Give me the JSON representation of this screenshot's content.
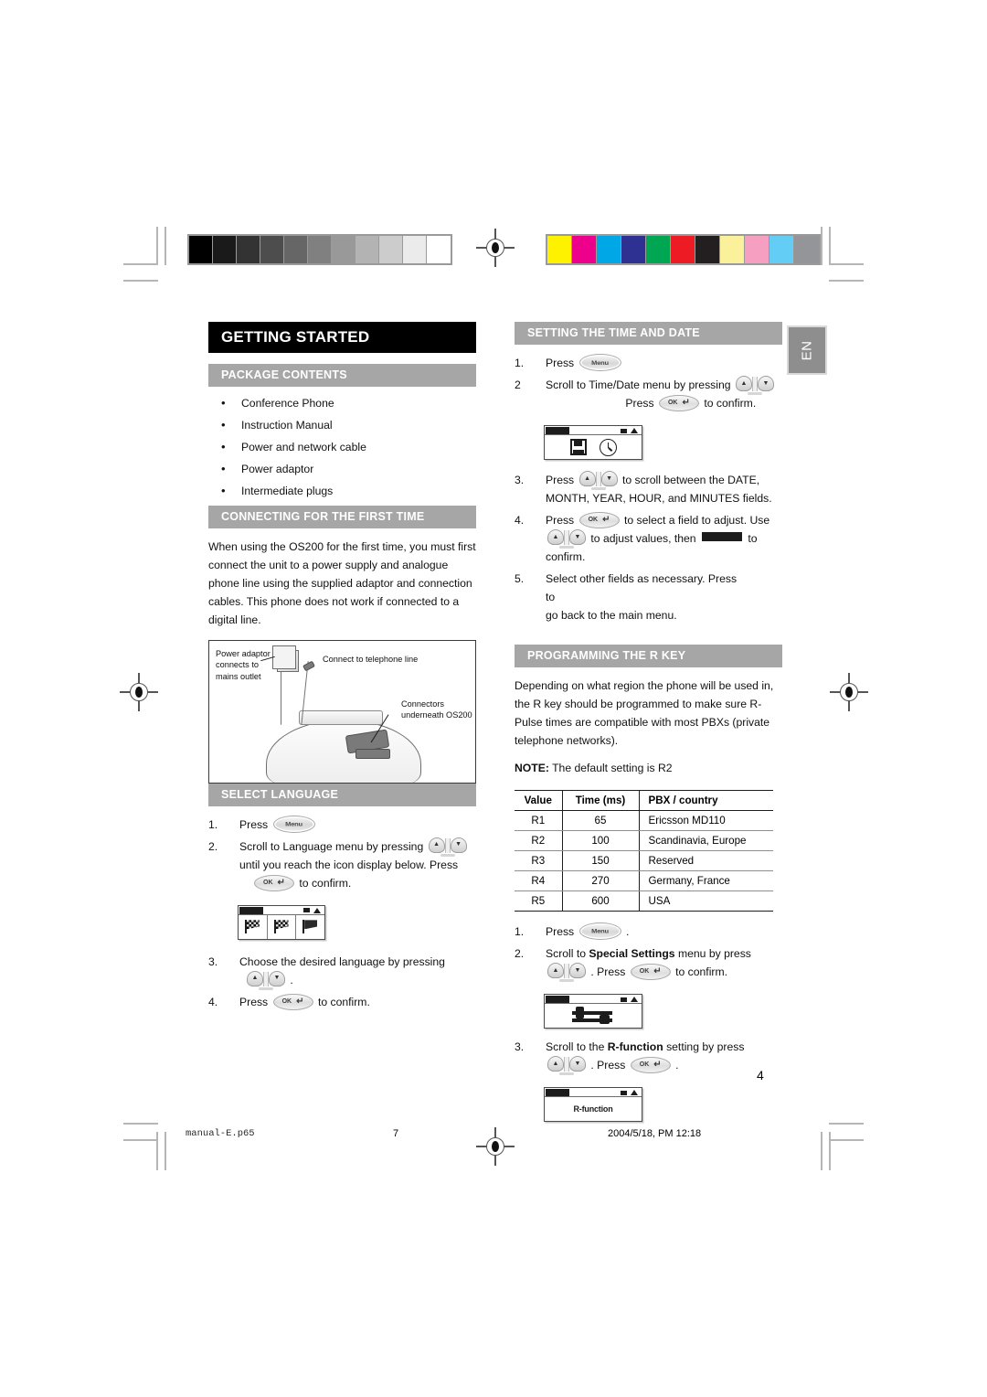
{
  "page": {
    "language_badge": "EN",
    "page_number": "4"
  },
  "footer": {
    "file_name": "manual-E.p65",
    "sheet_number": "7",
    "timestamp": "2004/5/18, PM 12:18"
  },
  "calibration": {
    "grayscale_swatches": [
      "#000000",
      "#1a1a1a",
      "#333333",
      "#4d4d4d",
      "#666666",
      "#808080",
      "#999999",
      "#b3b3b3",
      "#cccccc",
      "#ebebeb",
      "#ffffff"
    ],
    "color_swatches": [
      "#fff200",
      "#ec008c",
      "#00a7e7",
      "#2e3192",
      "#00a651",
      "#ed1c24",
      "#231f20",
      "#fbf19a",
      "#f79fc0",
      "#63cdf6",
      "#939598"
    ]
  },
  "left_column": {
    "title": "GETTING STARTED",
    "package_contents": {
      "heading": "PACKAGE CONTENTS",
      "items": [
        "Conference Phone",
        "Instruction Manual",
        "Power and network cable",
        "Power adaptor",
        "Intermediate plugs"
      ]
    },
    "connecting": {
      "heading": "CONNECTING FOR THE FIRST TIME",
      "paragraph": "When using the OS200 for the first time, you must first connect the unit to a power supply and analogue phone line using the supplied adaptor and connection cables. This phone does not work if connected to a digital line.",
      "illustration_labels": {
        "power_adaptor": "Power adaptor connects to mains outlet",
        "telephone_line": "Connect to telephone line",
        "connectors": "Connectors underneath OS200"
      }
    },
    "select_language": {
      "heading": "SELECT LANGUAGE",
      "steps": [
        {
          "num": "1.",
          "text_before": "Press",
          "key": "menu-key",
          "text_after": ""
        },
        {
          "num": "2.",
          "line1_before": "Scroll to Language menu by pressing",
          "line1_key": "up-down-key",
          "line2": "until you reach the icon display below. Press",
          "line3_key": "ok-key",
          "line3_after": "to confirm."
        },
        {
          "num": "3.",
          "line1": "Choose the desired language by pressing",
          "line2_key": "up-down-key",
          "line2_after": "."
        },
        {
          "num": "4.",
          "text_before": "Press",
          "key": "ok-key",
          "text_after": "to confirm."
        }
      ],
      "lcd_caption": "language-flags-display"
    }
  },
  "right_column": {
    "time_date": {
      "heading": "SETTING THE TIME AND DATE",
      "steps": [
        {
          "num": "1.",
          "text_before": "Press",
          "key": "menu-key",
          "text_after": ""
        },
        {
          "num": "2",
          "line1_before": "Scroll to Time/Date menu by pressing",
          "line1_key": "up-down-key",
          "sub": ".",
          "line2_before": "Press",
          "line2_key": "ok-key",
          "line2_after": "to confirm."
        },
        {
          "num": "3.",
          "line1_before": "Press",
          "line1_key": "up-down-key",
          "line1_after": "to scroll between the DATE,",
          "line2": "MONTH, YEAR, HOUR, and MINUTES fields."
        },
        {
          "num": "4.",
          "line1_before": "Press",
          "line1_key": "ok-key",
          "line1_after": "to select a field to adjust. Use",
          "line2_key": "up-down-key",
          "line2_mid": "to adjust values, then",
          "line2_key2": "redacted-key",
          "line2_after": "to",
          "line3": "confirm."
        },
        {
          "num": "5.",
          "line1_before": "Select other fields as necessary. Press",
          "line1_key": "blank-key",
          "line1_after": "to",
          "line2": "go back to the main menu."
        }
      ],
      "lcd_caption": "time-date-display"
    },
    "r_key": {
      "heading": "PROGRAMMING THE R KEY",
      "paragraph": "Depending on what region the phone will be used in, the R key should be programmed to make sure R-Pulse times are compatible with most PBXs (private telephone networks).",
      "note_label": "NOTE:",
      "note_text": "The default setting is R2",
      "table": {
        "headers": [
          "Value",
          "Time (ms)",
          "PBX / country"
        ],
        "rows": [
          [
            "R1",
            "65",
            "Ericsson MD110"
          ],
          [
            "R2",
            "100",
            "Scandinavia, Europe"
          ],
          [
            "R3",
            "150",
            "Reserved"
          ],
          [
            "R4",
            "270",
            "Germany, France"
          ],
          [
            "R5",
            "600",
            "USA"
          ]
        ]
      },
      "steps": [
        {
          "num": "1.",
          "text_before": "Press",
          "key": "menu-key",
          "text_after": "."
        },
        {
          "num": "2.",
          "line1_before": "Scroll to",
          "line1_bold": "Special Settings",
          "line1_after": "menu by press",
          "line2_key": "up-down-key",
          "line2_mid": ". Press",
          "line2_key2": "ok-key",
          "line2_after": "to confirm."
        },
        {
          "num": "3.",
          "line1_before": "Scroll to the",
          "line1_bold": "R-function",
          "line1_after": "setting by press",
          "line2_key": "up-down-key",
          "line2_mid": ". Press",
          "line2_key2": "ok-key",
          "line2_after": "."
        }
      ],
      "lcd_special_settings": "special-settings-display",
      "lcd_r_function_text": "R-function"
    }
  },
  "keys": {
    "menu_label": "Menu",
    "ok_label": "OK",
    "ok_hook": "↵",
    "up_arrow": "▲",
    "down_arrow": "▼"
  }
}
